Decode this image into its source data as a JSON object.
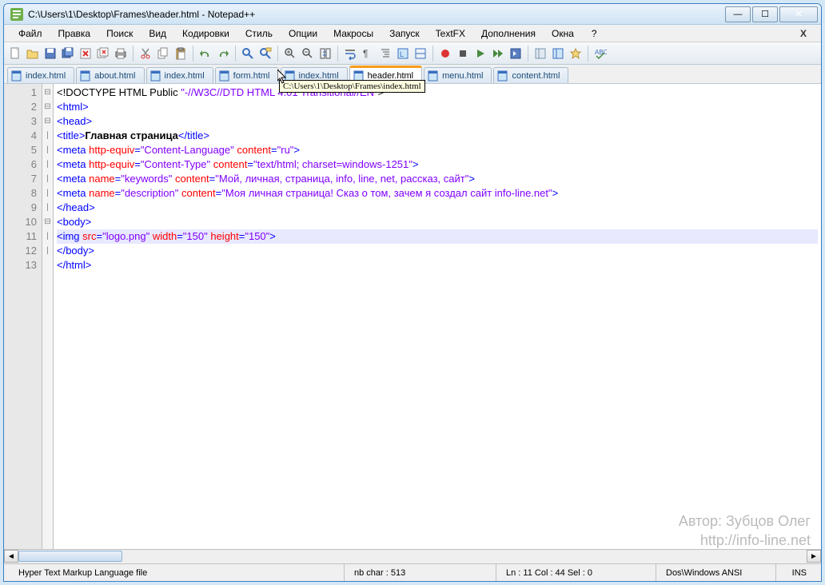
{
  "titlebar": {
    "title": "C:\\Users\\1\\Desktop\\Frames\\header.html - Notepad++"
  },
  "menubar": {
    "items": [
      "Файл",
      "Правка",
      "Поиск",
      "Вид",
      "Кодировки",
      "Стиль",
      "Опции",
      "Макросы",
      "Запуск",
      "TextFX",
      "Дополнения",
      "Окна",
      "?"
    ]
  },
  "tabs": [
    {
      "label": "index.html",
      "active": false
    },
    {
      "label": "about.html",
      "active": false
    },
    {
      "label": "index.html",
      "active": false
    },
    {
      "label": "form.html",
      "active": false
    },
    {
      "label": "index.html",
      "active": false
    },
    {
      "label": "header.html",
      "active": true
    },
    {
      "label": "menu.html",
      "active": false
    },
    {
      "label": "content.html",
      "active": false
    }
  ],
  "tooltip": "C:\\Users\\1\\Desktop\\Frames\\index.html",
  "code_lines": [
    {
      "n": 1,
      "fold": "⊟",
      "html": "<span class='t-doctype'>&lt;!DOCTYPE HTML Public </span><span class='t-doctype-str'>\"-//W3C//DTD HTML 4.01 Transitional//EN\"</span><span class='t-doctype'>&gt;</span>"
    },
    {
      "n": 2,
      "fold": "⊟",
      "html": "<span class='t-tag'>&lt;html&gt;</span>"
    },
    {
      "n": 3,
      "fold": "⊟",
      "html": "<span class='t-tag'>&lt;head&gt;</span>"
    },
    {
      "n": 4,
      "fold": "|",
      "html": "<span class='t-tag'>&lt;title&gt;</span><span class='t-text'>Главная страница</span><span class='t-tag'>&lt;/title&gt;</span>"
    },
    {
      "n": 5,
      "fold": "|",
      "html": "<span class='t-tag'>&lt;meta</span> <span class='t-attr'>http-equiv</span><span class='t-tag'>=</span><span class='t-str'>\"Content-Language\"</span> <span class='t-attr'>content</span><span class='t-tag'>=</span><span class='t-str'>\"ru\"</span><span class='t-tag'>&gt;</span>"
    },
    {
      "n": 6,
      "fold": "|",
      "html": "<span class='t-tag'>&lt;meta</span> <span class='t-attr'>http-equiv</span><span class='t-tag'>=</span><span class='t-str'>\"Content-Type\"</span> <span class='t-attr'>content</span><span class='t-tag'>=</span><span class='t-str'>\"text/html; charset=windows-1251\"</span><span class='t-tag'>&gt;</span>"
    },
    {
      "n": 7,
      "fold": "|",
      "html": "<span class='t-tag'>&lt;meta</span> <span class='t-attr'>name</span><span class='t-tag'>=</span><span class='t-str'>\"keywords\"</span> <span class='t-attr'>content</span><span class='t-tag'>=</span><span class='t-str'>\"Мой, личная, страница, info, line, net, рассказ, сайт\"</span><span class='t-tag'>&gt;</span>"
    },
    {
      "n": 8,
      "fold": "|",
      "html": "<span class='t-tag'>&lt;meta</span> <span class='t-attr'>name</span><span class='t-tag'>=</span><span class='t-str'>\"description\"</span> <span class='t-attr'>content</span><span class='t-tag'>=</span><span class='t-str'>\"Моя личная страница! Сказ о том, зачем я создал сайт info-line.net\"</span><span class='t-tag'>&gt;</span>"
    },
    {
      "n": 9,
      "fold": "|",
      "html": "<span class='t-tag'>&lt;/head&gt;</span>"
    },
    {
      "n": 10,
      "fold": "⊟",
      "html": "<span class='t-tag'>&lt;body&gt;</span>"
    },
    {
      "n": 11,
      "fold": "|",
      "hl": true,
      "html": "<span class='t-tag'>&lt;img</span> <span class='t-attr'>src</span><span class='t-tag'>=</span><span class='t-str'>\"logo.png\"</span> <span class='t-attr'>width</span><span class='t-tag'>=</span><span class='t-str'>\"150\"</span> <span class='t-attr'>height</span><span class='t-tag'>=</span><span class='t-str'>\"150\"</span><span class='t-tag'>&gt;</span>"
    },
    {
      "n": 12,
      "fold": "|",
      "html": "<span class='t-tag'>&lt;/body&gt;</span>"
    },
    {
      "n": 13,
      "fold": "",
      "html": "<span class='t-tag'>&lt;/html&gt;</span>"
    }
  ],
  "statusbar": {
    "type": "Hyper Text Markup Language file",
    "chars": "nb char : 513",
    "pos": "Ln : 11   Col : 44   Sel : 0",
    "enc": "Dos\\Windows  ANSI",
    "ins": "INS"
  },
  "watermark": {
    "line1": "Автор: Зубцов Олег",
    "line2": "http://info-line.net"
  }
}
